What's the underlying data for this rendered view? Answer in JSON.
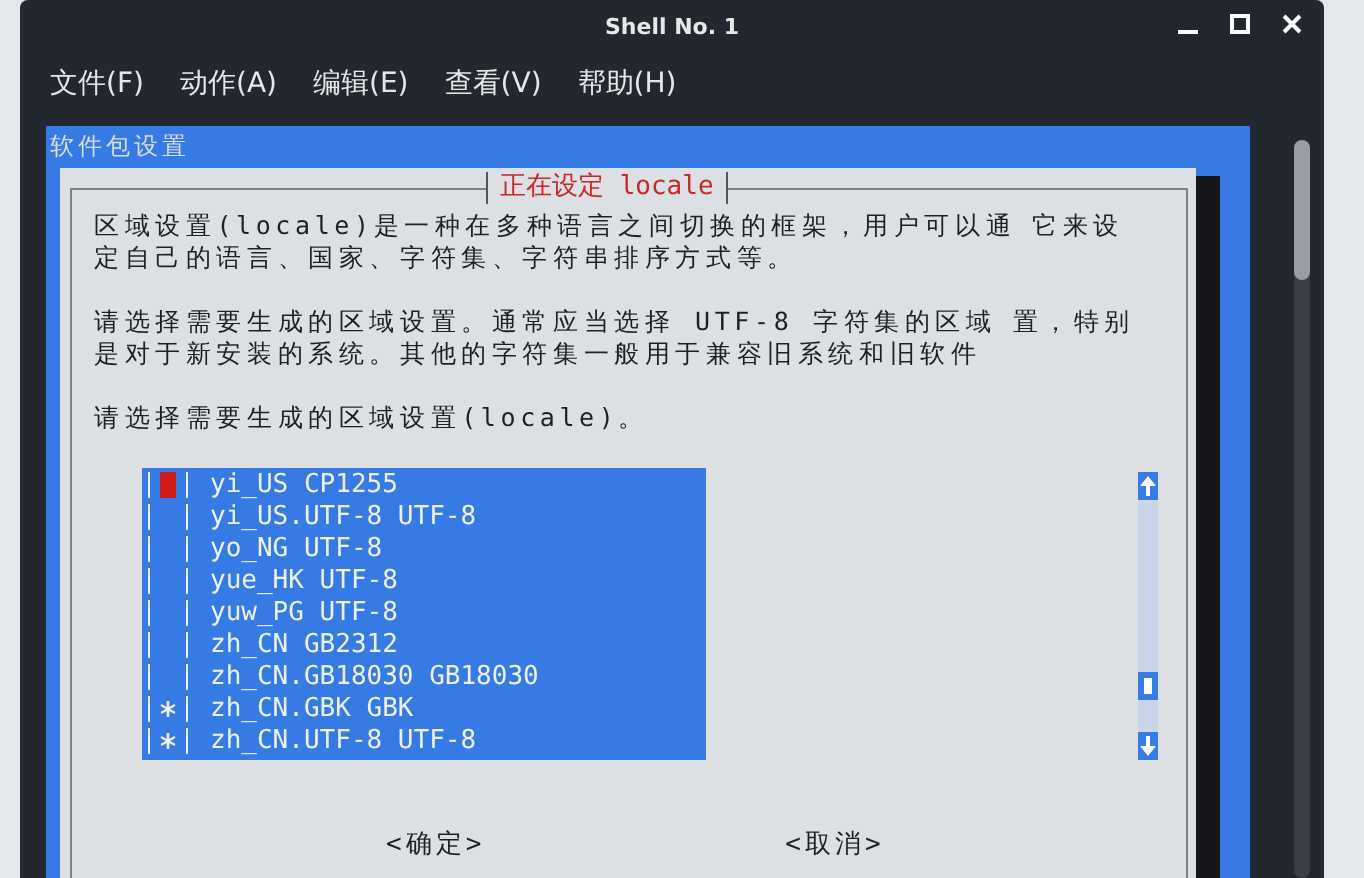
{
  "window": {
    "title": "Shell No. 1"
  },
  "menu": [
    "文件(F)",
    "动作(A)",
    "编辑(E)",
    "查看(V)",
    "帮助(H)"
  ],
  "terminal": {
    "header": "软件包设置"
  },
  "dialog": {
    "title": "正在设定 locale",
    "paragraphs": [
      [
        [
          "区域设置(locale)是一种在多种语言之间切换的框架，用户可以通",
          "它来设"
        ],
        [
          "定自己的语言、国家、字符集、字符串排序方式等。"
        ]
      ],
      [
        [
          "请选择需要生成的区域设置。通常应当选择 UTF-8 字符集的区域",
          "置，特别"
        ],
        [
          "是对于新安装的系统。其他的字符集一般用于兼容旧系统和旧软件"
        ]
      ],
      [
        [
          "请选择需要生成的区域设置(locale)。"
        ]
      ]
    ],
    "items": [
      {
        "label": "yi_US CP1255",
        "checked": false,
        "selected": true
      },
      {
        "label": "yi_US.UTF-8 UTF-8",
        "checked": false,
        "selected": false
      },
      {
        "label": "yo_NG UTF-8",
        "checked": false,
        "selected": false
      },
      {
        "label": "yue_HK UTF-8",
        "checked": false,
        "selected": false
      },
      {
        "label": "yuw_PG UTF-8",
        "checked": false,
        "selected": false
      },
      {
        "label": "zh_CN GB2312",
        "checked": false,
        "selected": false
      },
      {
        "label": "zh_CN.GB18030 GB18030",
        "checked": false,
        "selected": false
      },
      {
        "label": "zh_CN.GBK GBK",
        "checked": true,
        "selected": false
      },
      {
        "label": "zh_CN.UTF-8 UTF-8",
        "checked": true,
        "selected": false
      }
    ],
    "buttons": [
      "<确定>",
      "<取消>"
    ]
  }
}
